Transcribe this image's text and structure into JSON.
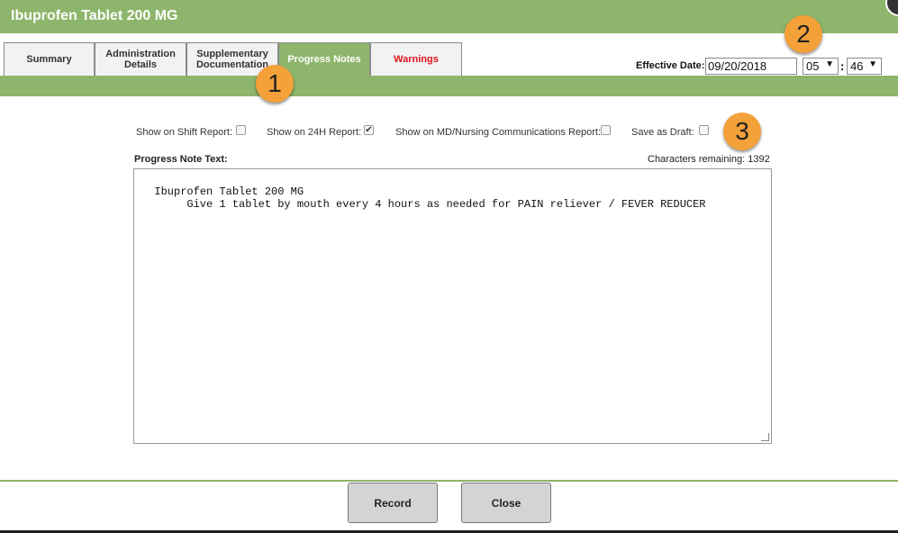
{
  "window": {
    "title": "Ibuprofen Tablet 200 MG"
  },
  "tabs": [
    {
      "label": "Summary",
      "active": false
    },
    {
      "label": "Administration Details",
      "active": false
    },
    {
      "label": "Supplementary Documentation",
      "active": false
    },
    {
      "label": "Progress Notes",
      "active": true
    },
    {
      "label": "Warnings",
      "active": false
    }
  ],
  "effective": {
    "label": "Effective Date:",
    "date": "09/20/2018",
    "hour": "05",
    "minute": "46",
    "separator": ":"
  },
  "callouts": [
    "1",
    "2",
    "3"
  ],
  "options": [
    {
      "label": "Show on Shift Report:",
      "checked": false
    },
    {
      "label": "Show on 24H Report:",
      "checked": true
    },
    {
      "label": "Show on MD/Nursing Communications Report:",
      "checked": false
    },
    {
      "label": "Save as Draft:",
      "checked": false
    }
  ],
  "progress_note": {
    "label": "Progress Note Text:",
    "chars_remaining": "Characters remaining: 1392",
    "text": "Ibuprofen Tablet 200 MG\n       Give 1 tablet by mouth every 4 hours as needed for PAIN reliever / FEVER REDUCER"
  },
  "buttons": {
    "record": "Record",
    "close": "Close"
  },
  "colors": {
    "header_green": "#8db56b",
    "callout_orange": "#f5a13a",
    "warning_red": "#e0141e"
  }
}
